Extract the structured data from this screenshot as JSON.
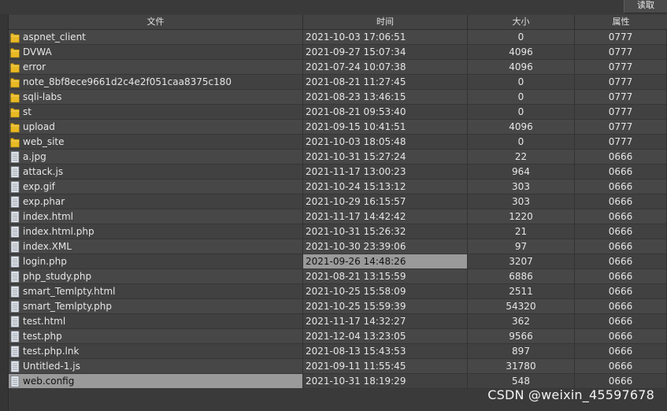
{
  "toolbar": {
    "read_button": "读取"
  },
  "columns": {
    "name": "文件",
    "time": "时间",
    "size": "大小",
    "attr": "属性"
  },
  "rows": [
    {
      "type": "folder",
      "name": "aspnet_client",
      "time": "2021-10-03 17:06:51",
      "size": "0",
      "attr": "0777"
    },
    {
      "type": "folder",
      "name": "DVWA",
      "time": "2021-09-27 15:07:34",
      "size": "4096",
      "attr": "0777"
    },
    {
      "type": "folder",
      "name": "error",
      "time": "2021-07-24 10:07:38",
      "size": "4096",
      "attr": "0777"
    },
    {
      "type": "folder",
      "name": "note_8bf8ece9661d2c4e2f051caa8375c180",
      "time": "2021-08-21 11:27:45",
      "size": "0",
      "attr": "0777"
    },
    {
      "type": "folder",
      "name": "sqli-labs",
      "time": "2021-08-23 13:46:15",
      "size": "0",
      "attr": "0777"
    },
    {
      "type": "folder",
      "name": "st",
      "time": "2021-08-21 09:53:40",
      "size": "0",
      "attr": "0777"
    },
    {
      "type": "folder",
      "name": "upload",
      "time": "2021-09-15 10:41:51",
      "size": "4096",
      "attr": "0777"
    },
    {
      "type": "folder",
      "name": "web_site",
      "time": "2021-10-03 18:05:48",
      "size": "0",
      "attr": "0777"
    },
    {
      "type": "file",
      "name": "a.jpg",
      "time": "2021-10-31 15:27:24",
      "size": "22",
      "attr": "0666"
    },
    {
      "type": "file",
      "name": "attack.js",
      "time": "2021-11-17 13:00:23",
      "size": "964",
      "attr": "0666"
    },
    {
      "type": "file",
      "name": "exp.gif",
      "time": "2021-10-24 15:13:12",
      "size": "303",
      "attr": "0666"
    },
    {
      "type": "file",
      "name": "exp.phar",
      "time": "2021-10-29 16:15:57",
      "size": "303",
      "attr": "0666"
    },
    {
      "type": "file",
      "name": "index.html",
      "time": "2021-11-17 14:42:42",
      "size": "1220",
      "attr": "0666"
    },
    {
      "type": "file",
      "name": "index.html.php",
      "time": "2021-10-31 15:26:32",
      "size": "21",
      "attr": "0666"
    },
    {
      "type": "file",
      "name": "index.XML",
      "time": "2021-10-30 23:39:06",
      "size": "97",
      "attr": "0666"
    },
    {
      "type": "file",
      "name": "login.php",
      "time": "2021-09-26 14:48:26",
      "size": "3207",
      "attr": "0666",
      "selected": "time"
    },
    {
      "type": "file",
      "name": "php_study.php",
      "time": "2021-08-21 13:15:59",
      "size": "6886",
      "attr": "0666"
    },
    {
      "type": "file",
      "name": "smart_Temlpty.html",
      "time": "2021-10-25 15:58:09",
      "size": "2511",
      "attr": "0666"
    },
    {
      "type": "file",
      "name": "smart_Temlpty.php",
      "time": "2021-10-25 15:59:39",
      "size": "54320",
      "attr": "0666"
    },
    {
      "type": "file",
      "name": "test.html",
      "time": "2021-11-17 14:32:27",
      "size": "362",
      "attr": "0666"
    },
    {
      "type": "file",
      "name": "test.php",
      "time": "2021-12-04 13:23:05",
      "size": "9566",
      "attr": "0666"
    },
    {
      "type": "file",
      "name": "test.php.lnk",
      "time": "2021-08-13 15:43:53",
      "size": "897",
      "attr": "0666"
    },
    {
      "type": "file",
      "name": "Untitled-1.js",
      "time": "2021-09-11 11:55:45",
      "size": "31780",
      "attr": "0666"
    },
    {
      "type": "file",
      "name": "web.config",
      "time": "2021-10-31 18:19:29",
      "size": "548",
      "attr": "0666",
      "selected": "name"
    }
  ],
  "watermark": "CSDN @weixin_45597678",
  "colors": {
    "folder": "#e8b923",
    "file": "#d9dde3",
    "selection": "#9a9a9a"
  }
}
